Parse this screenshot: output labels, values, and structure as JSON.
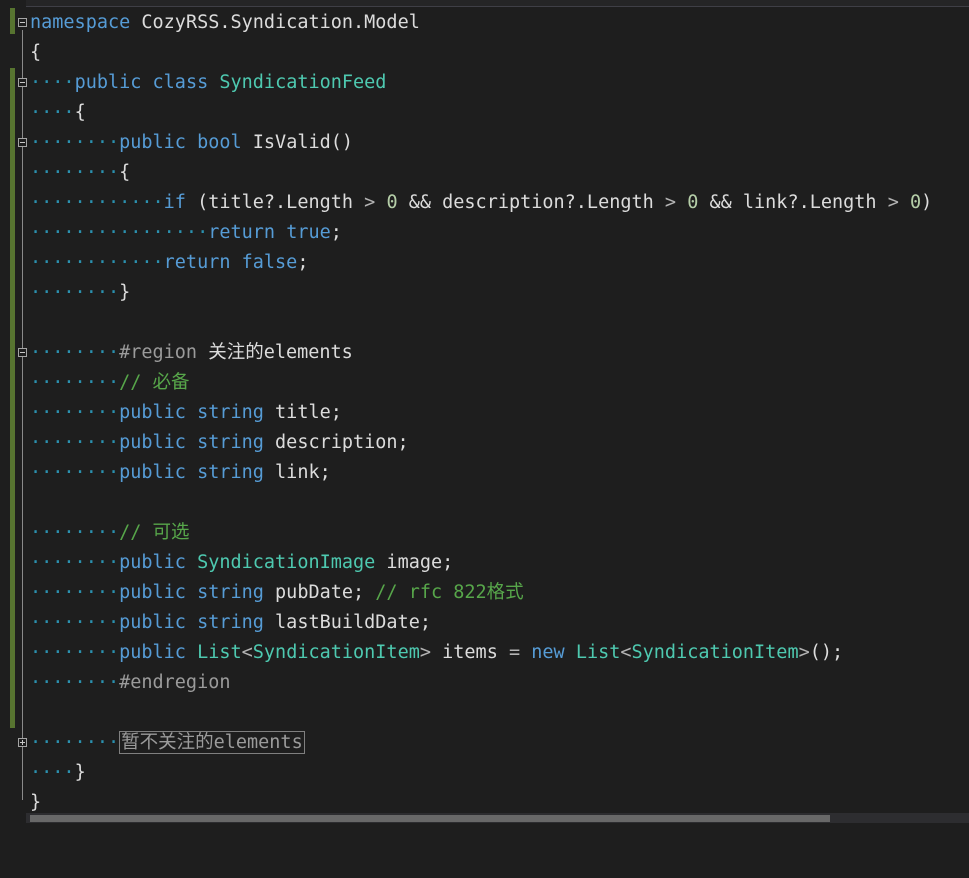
{
  "namespace_line": {
    "kw": "namespace",
    "name": "CozyRSS.Syndication.Model"
  },
  "class_line": {
    "kw1": "public",
    "kw2": "class",
    "type": "SyndicationFeed"
  },
  "method_line": {
    "kw1": "public",
    "kw2": "bool",
    "name": "IsValid()"
  },
  "if_line": {
    "kw": "if",
    "part1": " (title?.Length ",
    "gt1": ">",
    "sp1": " ",
    "n1": "0",
    "and1": " && ",
    "part2": "description?.Length ",
    "gt2": ">",
    "sp2": " ",
    "n2": "0",
    "and2": " && ",
    "part3": "link?.Length ",
    "gt3": ">",
    "sp3": " ",
    "n3": "0",
    "close": ")"
  },
  "return_true": {
    "kw": "return",
    "val": "true",
    "semi": ";"
  },
  "return_false": {
    "kw": "return",
    "val": "false",
    "semi": ";"
  },
  "region_line": {
    "directive": "#region",
    "name": " 关注的elements"
  },
  "comment_required": "// 必备",
  "field_title": {
    "kw": "public",
    "type": "string",
    "name": " title;"
  },
  "field_description": {
    "kw": "public",
    "type": "string",
    "name": " description;"
  },
  "field_link": {
    "kw": "public",
    "type": "string",
    "name": " link;"
  },
  "comment_optional": "// 可选",
  "field_image": {
    "kw": "public",
    "type": "SyndicationImage",
    "name": " image;"
  },
  "field_pubdate": {
    "kw": "public",
    "type": "string",
    "name": " pubDate; ",
    "comment": "// rfc 822格式"
  },
  "field_lastbuild": {
    "kw": "public",
    "type": "string",
    "name": " lastBuildDate;"
  },
  "field_items": {
    "kw": "public",
    "list1": "List",
    "lt1": "<",
    "item1": "SyndicationItem",
    "gt1": ">",
    "name": " items ",
    "eq": "=",
    "sp": " ",
    "new": "new",
    "sp2": " ",
    "list2": "List",
    "lt2": "<",
    "item2": "SyndicationItem",
    "gt2": ">",
    "tail": "();"
  },
  "endregion": "#endregion",
  "collapsed_region": "暂不关注的elements",
  "brace_open": "{",
  "brace_close": "}",
  "colors": {
    "keyword": "#569cd6",
    "type": "#4ec9b0",
    "comment": "#57a64a",
    "preprocessor": "#9b9b9b",
    "number": "#b5cea8",
    "background": "#1e1e1e"
  }
}
